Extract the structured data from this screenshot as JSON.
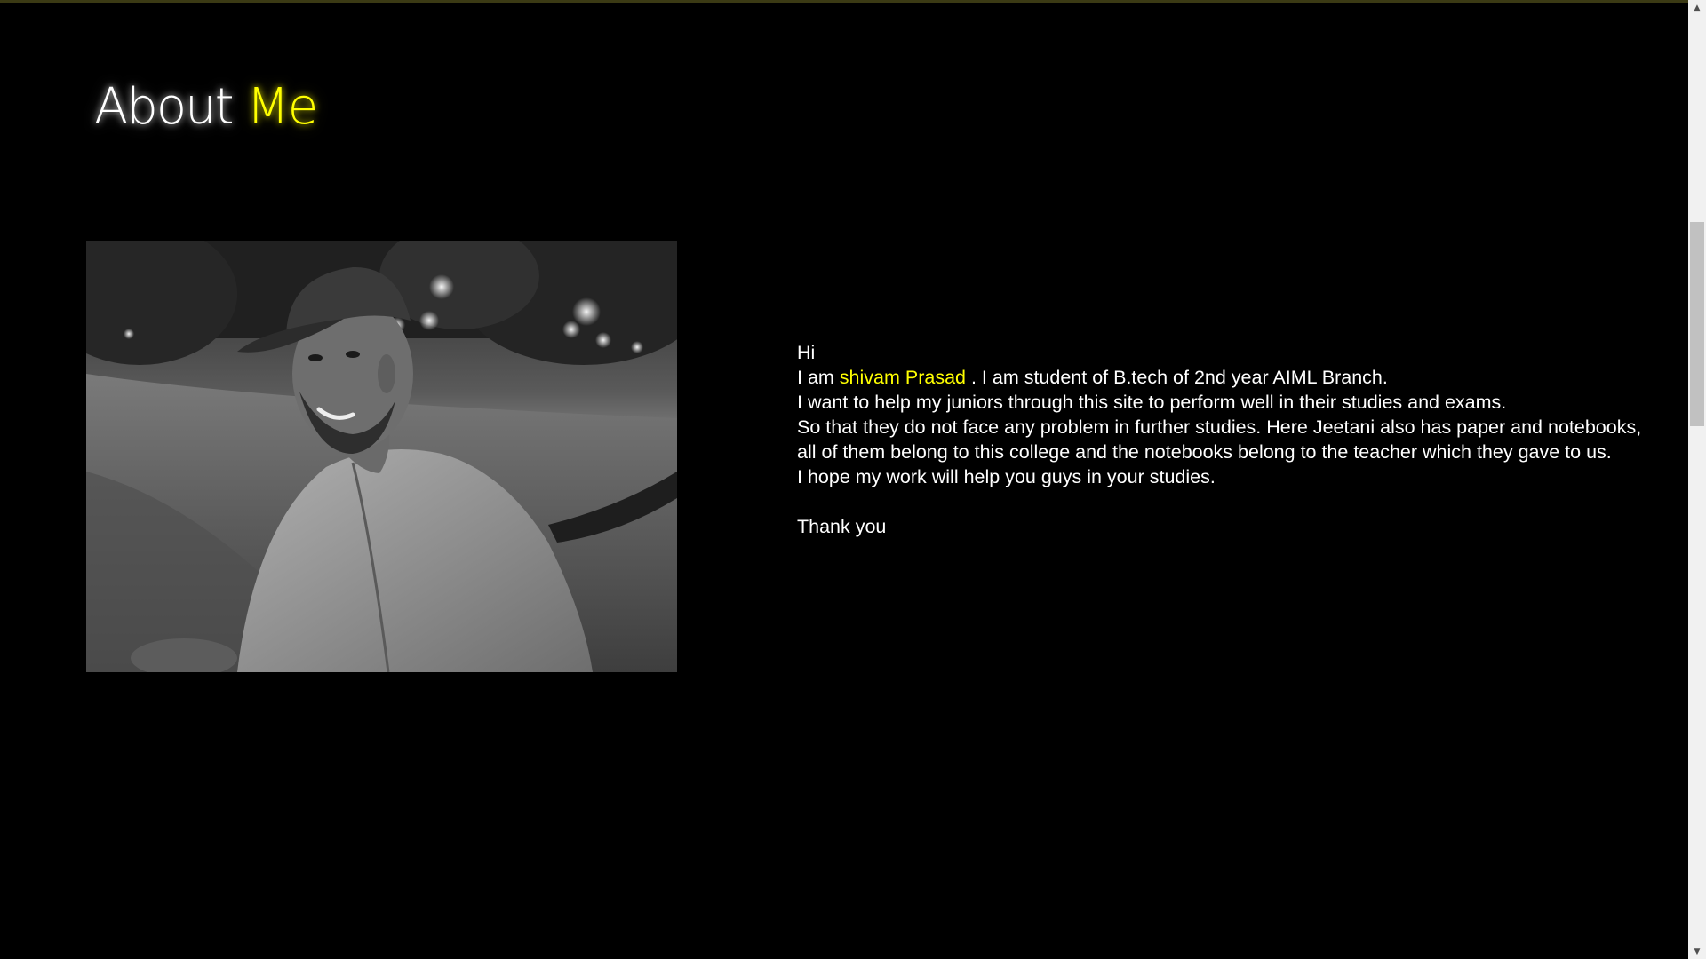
{
  "heading": {
    "part1": "About",
    "part2": "Me",
    "accent_color": "#ffff00"
  },
  "photo": {
    "description_icon": "profile-photo",
    "alt": "Profile photo"
  },
  "bio": {
    "greeting": "Hi",
    "intro_prefix": "I am ",
    "name": "shivam Prasad",
    "intro_suffix": " . I am student of B.tech of 2nd year AIML Branch.",
    "line2": "I want to help my juniors through this site to perform well in their studies and exams.",
    "line3": "So that they do not face any problem in further studies. Here Jeetani also has paper and notebooks,",
    "line4": "all of them belong to this college and the notebooks belong to the teacher which they gave to us.",
    "line5": "I hope my work will help you guys in your studies.",
    "closing": "Thank you"
  },
  "scrollbar": {
    "up_icon": "scroll-up-arrow-icon",
    "down_icon": "scroll-down-arrow-icon"
  }
}
